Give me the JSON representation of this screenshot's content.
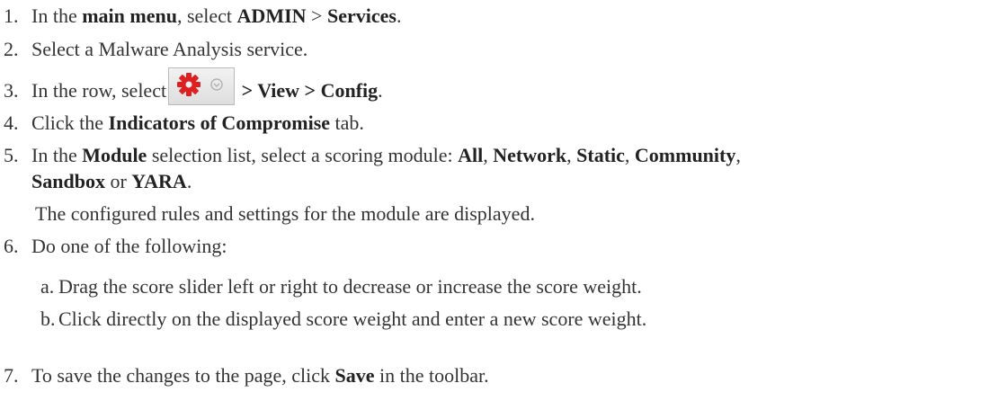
{
  "steps": [
    {
      "num": "1.",
      "t1": "In the ",
      "b1": "main menu",
      "t2": ", select ",
      "b2": "ADMIN",
      "t3": " > ",
      "b3": "Services",
      "t4": "."
    },
    {
      "num": "2.",
      "t1": "Select a Malware Analysis service."
    },
    {
      "num": "3.",
      "t1": "In the row, select",
      "b1": " > View > Config",
      "t2": "."
    },
    {
      "num": "4.",
      "t1": "Click the ",
      "b1": "Indicators of Compromise",
      "t2": " tab."
    },
    {
      "num": "5.",
      "t1": "In the ",
      "b1": "Module",
      "t2": " selection list, select a scoring module: ",
      "b2": "All",
      "t3": ", ",
      "b3": "Network",
      "t4": ", ",
      "b4": "Static",
      "t5": ", ",
      "b5": "Community",
      "t6": ",",
      "l2b1": "Sandbox",
      "l2t1": " or ",
      "l2b2": "YARA",
      "l2t2": ".",
      "note": "The configured rules and settings for the module are displayed."
    },
    {
      "num": "6.",
      "t1": "Do one of the following:",
      "subs": [
        {
          "letter": "a.",
          "text": "Drag the score slider left or right to decrease or increase the score weight."
        },
        {
          "letter": "b.",
          "text": "Click directly on the displayed score weight and enter a new score weight."
        }
      ]
    },
    {
      "num": "7.",
      "t1": "To save the changes to the page, click ",
      "b1": "Save",
      "t2": " in the toolbar."
    }
  ],
  "icons": {
    "gear": "gear-icon",
    "dropdown": "chevron-down-circle-icon",
    "gear_color": "#e02020"
  }
}
